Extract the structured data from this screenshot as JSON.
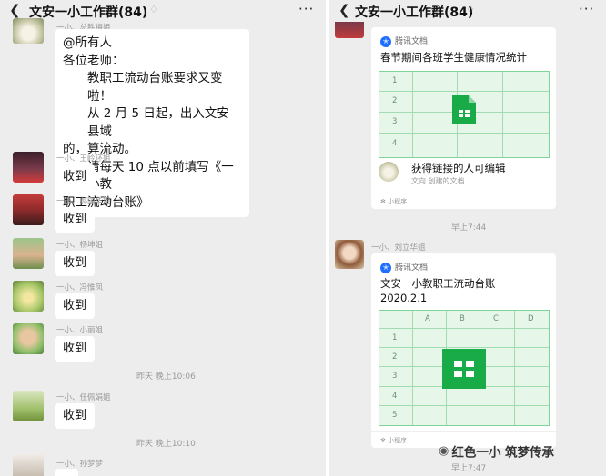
{
  "left": {
    "header": {
      "back_icon": "chevron-left-icon",
      "title": "文安一小工作群(84)",
      "mute_icon": "mute-bell-icon",
      "more_icon": "more-dots-icon"
    },
    "top_sender": "一小、总胜梅姐",
    "announcement": {
      "line1": "@所有人",
      "line2": "各位老师：",
      "line3": "教职工流动台账要求又变啦！",
      "line4": "从 2 月 5 日起，出入文安县域",
      "line5": "的，算流动。",
      "line6": "请每天 10 点以前填写《一小教",
      "line7": "职工流动台账》"
    },
    "messages": [
      {
        "sender": "一小、王岭环姐",
        "text": "收到"
      },
      {
        "sender": "一小、郝国华姐",
        "text": "收到"
      },
      {
        "sender": "一小、杨坤姐",
        "text": "收到"
      },
      {
        "sender": "一小、冯惟凤",
        "text": "收到"
      },
      {
        "sender": "一小、小丽姐",
        "text": "收到"
      },
      {
        "sender": "一小、任佩娟姐",
        "text": "收到"
      },
      {
        "sender": "一小、孙梦梦",
        "text": ""
      }
    ],
    "times": [
      "昨天 晚上10:06",
      "昨天 晚上10:10"
    ]
  },
  "right": {
    "header": {
      "back_icon": "chevron-left-icon",
      "title": "文安一小工作群(84)",
      "mute_icon": "mute-bell-icon",
      "more_icon": "more-dots-icon"
    },
    "card1": {
      "source": "腾讯文档",
      "title": "春节期间各班学生健康情况统计",
      "rows": [
        "1",
        "2",
        "3",
        "4"
      ],
      "share_text": "获得链接的人可编辑",
      "share_sub": "文向 创建的文档",
      "mini": "小程序"
    },
    "time1": "早上7:44",
    "sender2": "一小、刘立华姐",
    "card2": {
      "source": "腾讯文档",
      "title_line1": "文安一小教职工流动台账",
      "title_line2": "2020.2.1",
      "cols": [
        "A",
        "B",
        "C",
        "D"
      ],
      "rows": [
        "1",
        "2",
        "3",
        "4",
        "5"
      ],
      "mini": "小程序"
    },
    "time2": "早上7:47",
    "watermark": "红色一小 筑梦传承",
    "watermark_icon": "wechat-official-account-icon"
  },
  "colors": {
    "chat_bg": "#ededed",
    "bubble": "#ffffff",
    "sheet_green": "#1aab49",
    "grid_bg": "#e6f7ea"
  }
}
